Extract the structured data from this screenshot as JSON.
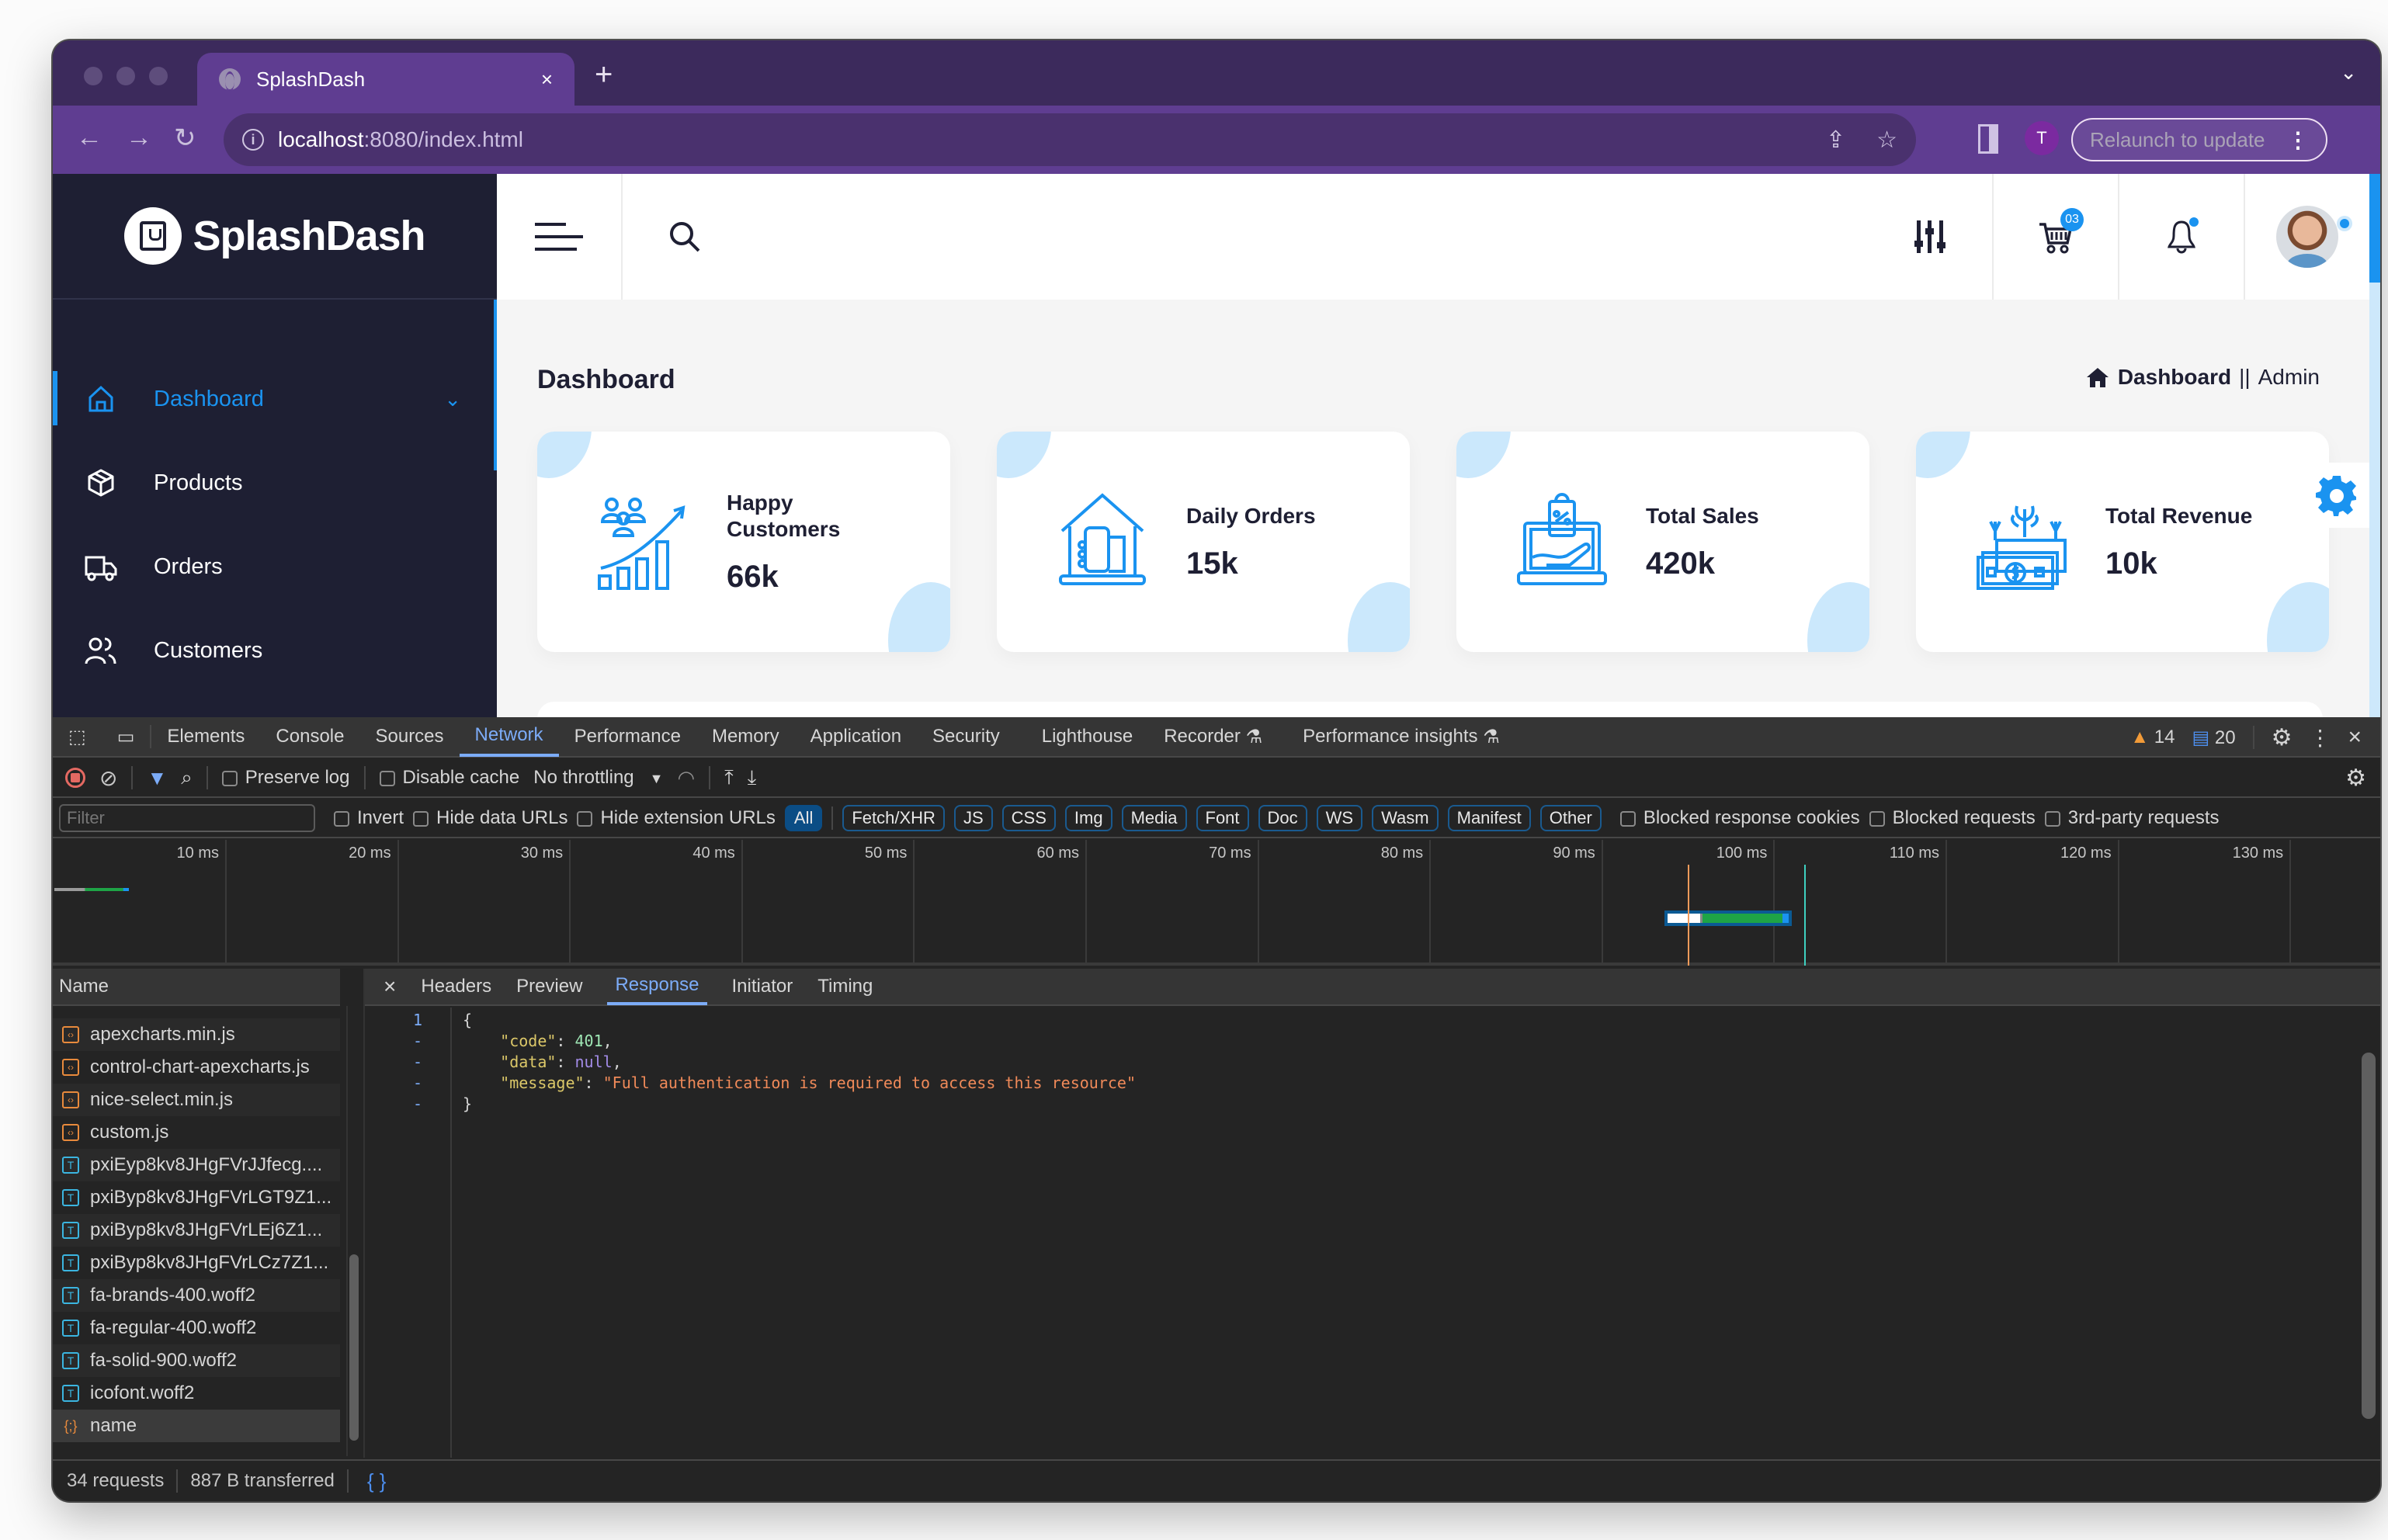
{
  "browser": {
    "tab_title": "SplashDash",
    "url_host": "localhost",
    "url_path": ":8080/index.html",
    "profile_initial": "T",
    "relaunch_label": "Relaunch to update"
  },
  "app": {
    "brand": "SplashDash",
    "accent_color": "#1a93f0",
    "sidebar": {
      "items": [
        {
          "label": "Dashboard",
          "icon": "home-icon",
          "active": true
        },
        {
          "label": "Products",
          "icon": "box-icon"
        },
        {
          "label": "Orders",
          "icon": "truck-icon"
        },
        {
          "label": "Customers",
          "icon": "users-icon"
        }
      ]
    },
    "topbar": {
      "cart_badge": "03"
    },
    "page_title": "Dashboard",
    "breadcrumb": {
      "current": "Dashboard",
      "separator": "||",
      "role": "Admin"
    },
    "cards": [
      {
        "label": "Happy Customers",
        "value": "66k",
        "icon": "customers-growth-icon"
      },
      {
        "label": "Daily Orders",
        "value": "15k",
        "icon": "store-orders-icon"
      },
      {
        "label": "Total Sales",
        "value": "420k",
        "icon": "laptop-sale-icon"
      },
      {
        "label": "Total Revenue",
        "value": "10k",
        "icon": "money-plant-icon"
      }
    ]
  },
  "devtools": {
    "tabs": [
      "Elements",
      "Console",
      "Sources",
      "Network",
      "Performance",
      "Memory",
      "Application",
      "Security",
      "Lighthouse",
      "Recorder",
      "Performance insights"
    ],
    "active_tab": "Network",
    "warnings": "14",
    "messages": "20",
    "toolbar": {
      "preserve_log": "Preserve log",
      "disable_cache": "Disable cache",
      "throttling": "No throttling"
    },
    "filter": {
      "placeholder": "Filter",
      "invert": "Invert",
      "hide_data_urls": "Hide data URLs",
      "hide_extension_urls": "Hide extension URLs",
      "types": [
        "All",
        "Fetch/XHR",
        "JS",
        "CSS",
        "Img",
        "Media",
        "Font",
        "Doc",
        "WS",
        "Wasm",
        "Manifest",
        "Other"
      ],
      "active_type": "All",
      "blocked_cookies": "Blocked response cookies",
      "blocked_requests": "Blocked requests",
      "third_party": "3rd-party requests"
    },
    "timeline_ticks": [
      "10 ms",
      "20 ms",
      "30 ms",
      "40 ms",
      "50 ms",
      "60 ms",
      "70 ms",
      "80 ms",
      "90 ms",
      "100 ms",
      "110 ms",
      "120 ms",
      "130 ms"
    ],
    "name_header": "Name",
    "requests": [
      {
        "name": "apexcharts.min.js",
        "type": "script"
      },
      {
        "name": "control-chart-apexcharts.js",
        "type": "script"
      },
      {
        "name": "nice-select.min.js",
        "type": "script"
      },
      {
        "name": "custom.js",
        "type": "script"
      },
      {
        "name": "pxiEyp8kv8JHgFVrJJfecg....",
        "type": "font"
      },
      {
        "name": "pxiByp8kv8JHgFVrLGT9Z1...",
        "type": "font"
      },
      {
        "name": "pxiByp8kv8JHgFVrLEj6Z1...",
        "type": "font"
      },
      {
        "name": "pxiByp8kv8JHgFVrLCz7Z1...",
        "type": "font"
      },
      {
        "name": "fa-brands-400.woff2",
        "type": "font"
      },
      {
        "name": "fa-regular-400.woff2",
        "type": "font"
      },
      {
        "name": "fa-solid-900.woff2",
        "type": "font"
      },
      {
        "name": "icofont.woff2",
        "type": "font"
      },
      {
        "name": "name",
        "type": "json",
        "selected": true
      }
    ],
    "detail_tabs": [
      "Headers",
      "Preview",
      "Response",
      "Initiator",
      "Timing"
    ],
    "active_detail_tab": "Response",
    "response": {
      "code_key": "\"code\"",
      "code_val": "401",
      "data_key": "\"data\"",
      "data_val": "null",
      "message_key": "\"message\"",
      "message_val": "\"Full authentication is required to access this resource\""
    },
    "status": {
      "requests": "34 requests",
      "transferred": "887 B transferred"
    }
  }
}
